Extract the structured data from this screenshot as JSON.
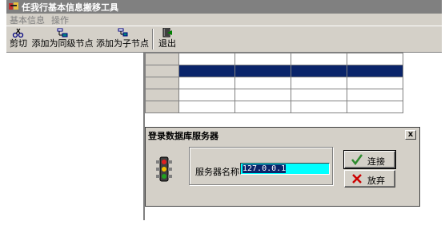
{
  "window": {
    "title": "任我行基本信息搬移工具"
  },
  "menu": [
    {
      "label": "基本信息"
    },
    {
      "label": "操作"
    }
  ],
  "toolbar": {
    "buttons": [
      {
        "label": "剪切",
        "icon": "cut-icon"
      },
      {
        "label": "添加为同级节点",
        "icon": "add-sibling-icon"
      },
      {
        "label": "添加为子节点",
        "icon": "add-child-icon"
      },
      {
        "label": "退出",
        "icon": "exit-icon"
      }
    ]
  },
  "grid": {
    "rows": 5,
    "columns": 4,
    "selected_row": 2
  },
  "dialog": {
    "title": "登录数据库服务器",
    "close_label": "x",
    "server_label": "服务器名称",
    "server_value": "127.0.0.1",
    "connect_label": "连接",
    "cancel_label": "放弃"
  },
  "colors": {
    "selection": "#0a246a",
    "input_bg": "#00ffff",
    "connect_check": "#2e8b2e",
    "cancel_x": "#cc0000"
  }
}
